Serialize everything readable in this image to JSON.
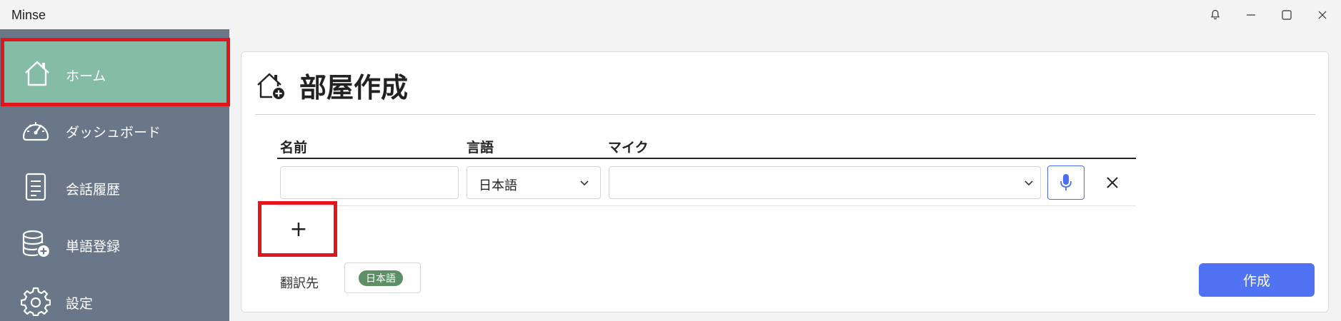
{
  "window": {
    "title": "Minse",
    "controls": [
      "bell-icon",
      "minimize-icon",
      "maximize-icon",
      "close-icon"
    ]
  },
  "sidebar": {
    "items": [
      {
        "label": "ホーム",
        "icon": "home-icon",
        "active": true
      },
      {
        "label": "ダッシュボード",
        "icon": "speedometer-icon",
        "active": false
      },
      {
        "label": "会話履歴",
        "icon": "document-icon",
        "active": false
      },
      {
        "label": "単語登録",
        "icon": "database-add-icon",
        "active": false
      },
      {
        "label": "設定",
        "icon": "gear-icon",
        "active": false
      }
    ]
  },
  "main": {
    "title": "部屋作成",
    "title_icon": "home-add-icon",
    "columns": {
      "name": "名前",
      "language": "言語",
      "mic": "マイク"
    },
    "row": {
      "name_value": "",
      "language_value": "日本語",
      "mic_value": ""
    },
    "add_button_label": "+",
    "translation_label": "翻訳先",
    "translation_languages": [
      "日本語"
    ],
    "create_button_label": "作成"
  },
  "colors": {
    "sidebar_bg": "#6a7789",
    "sidebar_active": "#84bca7",
    "accent_blue": "#4f73f2",
    "badge_green": "#5c8f66",
    "highlight_red": "#e0161c"
  }
}
